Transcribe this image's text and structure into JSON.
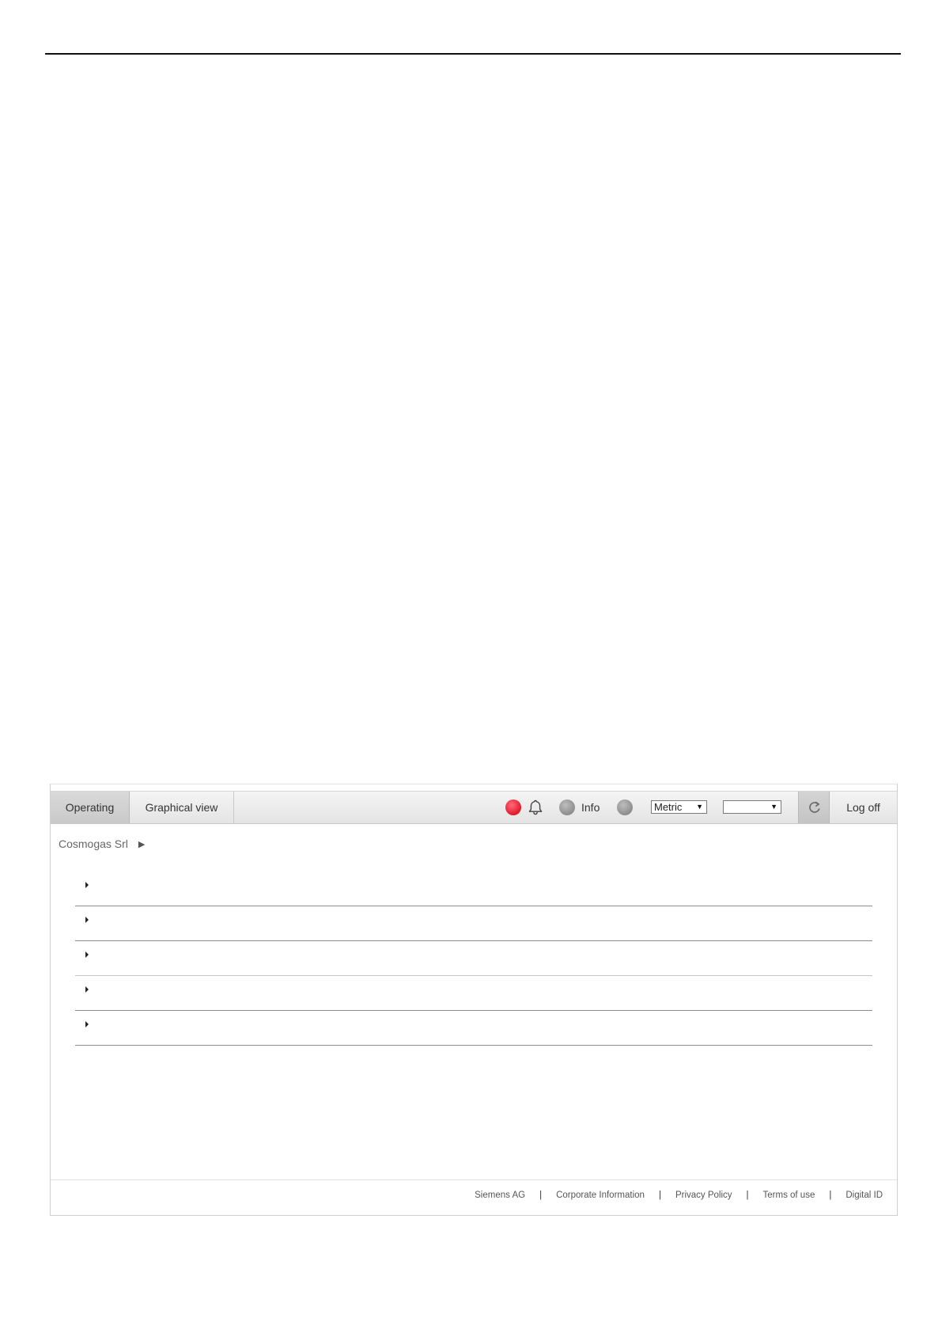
{
  "navbar": {
    "tabs": [
      {
        "label": "Operating"
      },
      {
        "label": "Graphical view"
      }
    ],
    "info_label": "Info",
    "units_select": {
      "value": "Metric"
    },
    "second_select": {
      "value": ""
    },
    "logoff_label": "Log off",
    "status_colors": {
      "alarm": "#e1192c",
      "neutral": "#8a8a8a"
    }
  },
  "breadcrumb": {
    "items": [
      {
        "label": "Cosmogas Srl"
      }
    ]
  },
  "rows": [
    {
      "label": ""
    },
    {
      "label": ""
    },
    {
      "label": ""
    },
    {
      "label": ""
    },
    {
      "label": ""
    }
  ],
  "footer": {
    "links": [
      {
        "label": "Siemens AG"
      },
      {
        "label": "Corporate Information"
      },
      {
        "label": "Privacy Policy"
      },
      {
        "label": "Terms of use"
      },
      {
        "label": "Digital ID"
      }
    ],
    "separator": "|"
  }
}
